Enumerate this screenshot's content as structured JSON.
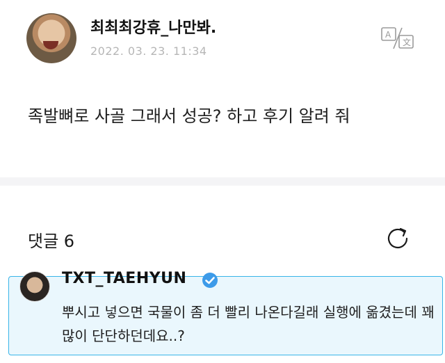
{
  "post": {
    "author": "최최최강휴_나만봐.",
    "date": "2022. 03. 23. 11:34",
    "content": "족발뼈로 사골 그래서 성공? 하고 후기 알려 줘"
  },
  "comments_section": {
    "title": "댓글 6"
  },
  "comment": {
    "author": "TXT_TAEHYUN",
    "text": "뿌시고 넣으면 국물이 좀 더 빨리 나온다길래 실행에 옮겼는데 꽤 많이 단단하던데요..?"
  },
  "colors": {
    "accent": "#38b4e8",
    "verified": "#3d9be9",
    "highlight_bg": "#eaf7fd"
  },
  "icons": [
    "translate-icon",
    "refresh-icon",
    "verified-badge-icon"
  ]
}
